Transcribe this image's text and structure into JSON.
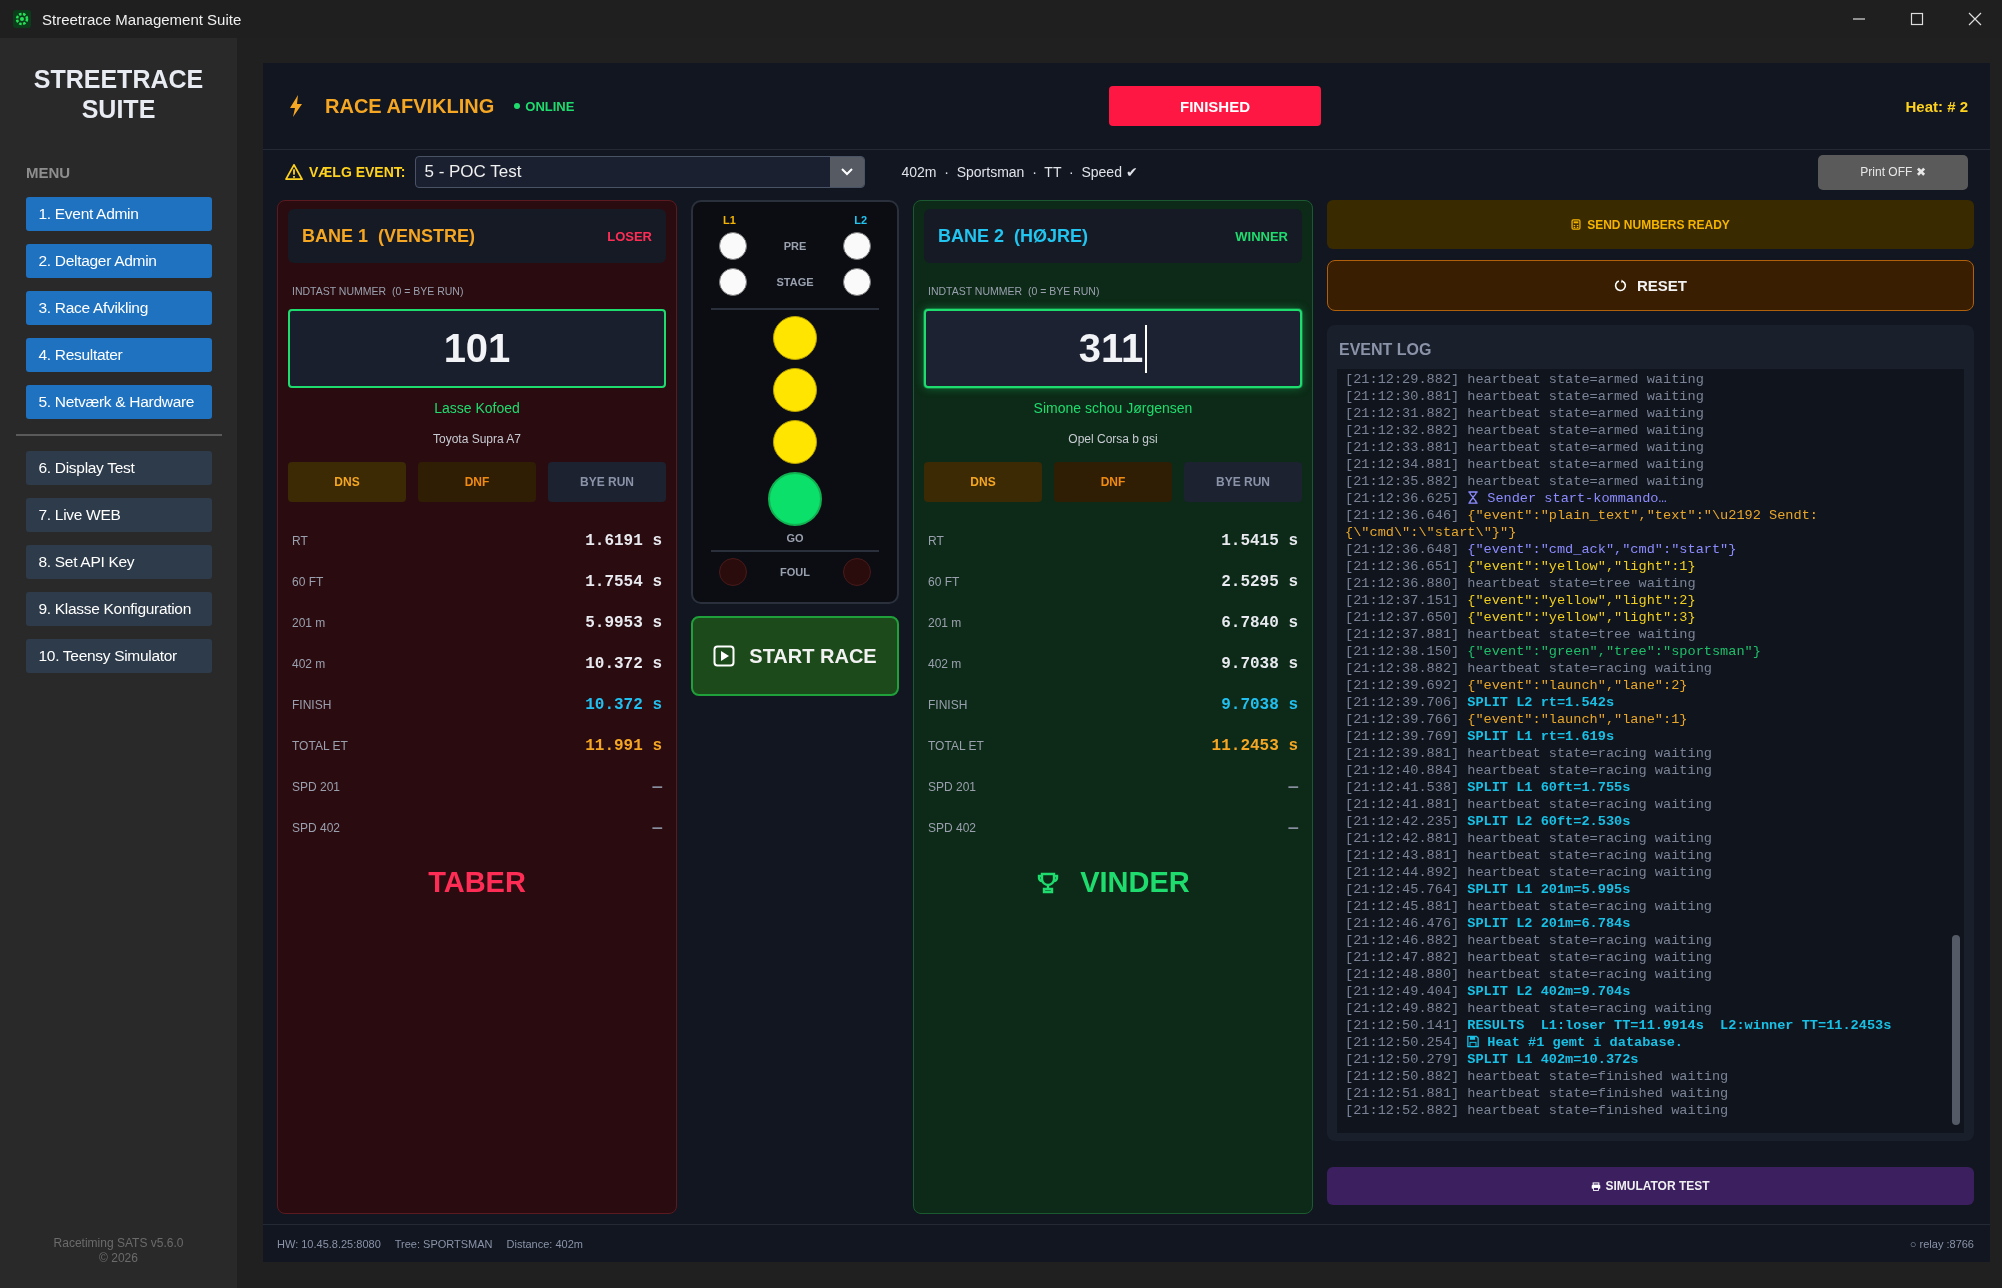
{
  "window": {
    "title": "Streetrace Management Suite"
  },
  "sidebar": {
    "brand": [
      "STREETRACE",
      "SUITE"
    ],
    "menu_label": "MENU",
    "items": [
      {
        "label": "1. Event Admin",
        "kind": "primary"
      },
      {
        "label": "2. Deltager Admin",
        "kind": "primary"
      },
      {
        "label": "3. Race Afvikling",
        "kind": "primary"
      },
      {
        "label": "4. Resultater",
        "kind": "primary"
      },
      {
        "label": "5. Netværk & Hardware",
        "kind": "primary"
      },
      {
        "label": "6. Display Test",
        "kind": "secondary"
      },
      {
        "label": "7. Live WEB",
        "kind": "secondary"
      },
      {
        "label": "8. Set API Key",
        "kind": "secondary"
      },
      {
        "label": "9. Klasse Konfiguration",
        "kind": "secondary"
      },
      {
        "label": "10. Teensy Simulator",
        "kind": "secondary"
      }
    ],
    "footer": [
      "Racetiming SATS v5.6.0",
      "© 2026"
    ]
  },
  "header": {
    "title": "RACE AFVIKLING",
    "connection": "ONLINE",
    "online": true,
    "race_state": "FINISHED",
    "heat": "Heat: # 2"
  },
  "event_bar": {
    "label": "VÆLG EVENT:",
    "selected_event": "5 - POC Test",
    "meta": "402m  ·  Sportsman  ·  TT  ·  Speed ✔",
    "print_button": "Print OFF ✖"
  },
  "lanes": [
    {
      "title": "BANE 1  (VENSTRE)",
      "badge": "LOSER",
      "kind": "loser",
      "input_label": "INDTAST NUMMER  (0 = BYE RUN)",
      "number": "101",
      "focused": false,
      "driver": "Lasse Kofoed",
      "car": "Toyota Supra A7",
      "buttons": [
        {
          "label": "DNS",
          "kind": "dns"
        },
        {
          "label": "DNF",
          "kind": "dnf"
        },
        {
          "label": "BYE RUN",
          "kind": "bye"
        }
      ],
      "stats": [
        {
          "label": "RT",
          "value": "1.6191 s",
          "kind": "time"
        },
        {
          "label": "60 FT",
          "value": "1.7554 s",
          "kind": "time"
        },
        {
          "label": "201 m",
          "value": "5.9953 s",
          "kind": "time"
        },
        {
          "label": "402 m",
          "value": "10.372 s",
          "kind": "time"
        },
        {
          "label": "FINISH",
          "value": "10.372 s",
          "kind": "finish"
        },
        {
          "label": "TOTAL ET",
          "value": "11.991 s",
          "kind": "total"
        },
        {
          "label": "SPD 201",
          "value": "—",
          "kind": "empty"
        },
        {
          "label": "SPD 402",
          "value": "—",
          "kind": "empty"
        }
      ],
      "result_banner": "TABER"
    },
    {
      "title": "BANE 2  (HØJRE)",
      "badge": "WINNER",
      "kind": "winner",
      "input_label": "INDTAST NUMMER  (0 = BYE RUN)",
      "number": "311",
      "focused": true,
      "driver": "Simone schou Jørgensen",
      "car": "Opel Corsa b gsi",
      "buttons": [
        {
          "label": "DNS",
          "kind": "dns"
        },
        {
          "label": "DNF",
          "kind": "dnf"
        },
        {
          "label": "BYE RUN",
          "kind": "bye"
        }
      ],
      "stats": [
        {
          "label": "RT",
          "value": "1.5415 s",
          "kind": "time"
        },
        {
          "label": "60 FT",
          "value": "2.5295 s",
          "kind": "time"
        },
        {
          "label": "201 m",
          "value": "6.7840 s",
          "kind": "time"
        },
        {
          "label": "402 m",
          "value": "9.7038 s",
          "kind": "time"
        },
        {
          "label": "FINISH",
          "value": "9.7038 s",
          "kind": "finish"
        },
        {
          "label": "TOTAL ET",
          "value": "11.2453 s",
          "kind": "total"
        },
        {
          "label": "SPD 201",
          "value": "—",
          "kind": "empty"
        },
        {
          "label": "SPD 402",
          "value": "—",
          "kind": "empty"
        }
      ],
      "result_banner": "VINDER"
    }
  ],
  "tree": {
    "lane_labels": [
      "L1",
      "L2"
    ],
    "stage_rows": [
      {
        "label": "PRE",
        "left_on": true,
        "right_on": true
      },
      {
        "label": "STAGE",
        "left_on": true,
        "right_on": true
      }
    ],
    "ambers": [
      {
        "on": true
      },
      {
        "on": true
      },
      {
        "on": true
      }
    ],
    "go": {
      "label": "GO",
      "on": true
    },
    "foul": {
      "label": "FOUL",
      "left_on": false,
      "right_on": false
    }
  },
  "start_button": "START RACE",
  "actions": {
    "send_numbers": "SEND NUMBERS READY",
    "reset": "RESET",
    "simulator": "SIMULATOR TEST"
  },
  "event_log": {
    "title": "EVENT LOG",
    "lines": [
      {
        "time": "[21:12:29.882]",
        "text": "heartbeat state=armed waiting",
        "kind": "heartbeat"
      },
      {
        "time": "[21:12:30.881]",
        "text": "heartbeat state=armed waiting",
        "kind": "heartbeat"
      },
      {
        "time": "[21:12:31.882]",
        "text": "heartbeat state=armed waiting",
        "kind": "heartbeat"
      },
      {
        "time": "[21:12:32.882]",
        "text": "heartbeat state=armed waiting",
        "kind": "heartbeat"
      },
      {
        "time": "[21:12:33.881]",
        "text": "heartbeat state=armed waiting",
        "kind": "heartbeat"
      },
      {
        "time": "[21:12:34.881]",
        "text": "heartbeat state=armed waiting",
        "kind": "heartbeat"
      },
      {
        "time": "[21:12:35.882]",
        "text": "heartbeat state=armed waiting",
        "kind": "heartbeat"
      },
      {
        "time": "[21:12:36.625]",
        "text": "Sender start-kommando…",
        "kind": "sending"
      },
      {
        "time": "[21:12:36.646]",
        "text": "{\"event\":\"plain_text\",\"text\":\"\\u2192 Sendt: {\\\"cmd\\\":\\\"start\\\"}\"}",
        "kind": "event"
      },
      {
        "time": "[21:12:36.648]",
        "text": "{\"event\":\"cmd_ack\",\"cmd\":\"start\"}",
        "kind": "ack"
      },
      {
        "time": "[21:12:36.651]",
        "text": "{\"event\":\"yellow\",\"light\":1}",
        "kind": "yellow"
      },
      {
        "time": "[21:12:36.880]",
        "text": "heartbeat state=tree waiting",
        "kind": "heartbeat"
      },
      {
        "time": "[21:12:37.151]",
        "text": "{\"event\":\"yellow\",\"light\":2}",
        "kind": "yellow"
      },
      {
        "time": "[21:12:37.650]",
        "text": "{\"event\":\"yellow\",\"light\":3}",
        "kind": "yellow"
      },
      {
        "time": "[21:12:37.881]",
        "text": "heartbeat state=tree waiting",
        "kind": "heartbeat"
      },
      {
        "time": "[21:12:38.150]",
        "text": "{\"event\":\"green\",\"tree\":\"sportsman\"}",
        "kind": "green"
      },
      {
        "time": "[21:12:38.882]",
        "text": "heartbeat state=racing waiting",
        "kind": "heartbeat"
      },
      {
        "time": "[21:12:39.692]",
        "text": "{\"event\":\"launch\",\"lane\":2}",
        "kind": "event"
      },
      {
        "time": "[21:12:39.706]",
        "text": "SPLIT L2 rt=1.542s",
        "kind": "split"
      },
      {
        "time": "[21:12:39.766]",
        "text": "{\"event\":\"launch\",\"lane\":1}",
        "kind": "event"
      },
      {
        "time": "[21:12:39.769]",
        "text": "SPLIT L1 rt=1.619s",
        "kind": "split"
      },
      {
        "time": "[21:12:39.881]",
        "text": "heartbeat state=racing waiting",
        "kind": "heartbeat"
      },
      {
        "time": "[21:12:40.884]",
        "text": "heartbeat state=racing waiting",
        "kind": "heartbeat"
      },
      {
        "time": "[21:12:41.538]",
        "text": "SPLIT L1 60ft=1.755s",
        "kind": "split"
      },
      {
        "time": "[21:12:41.881]",
        "text": "heartbeat state=racing waiting",
        "kind": "heartbeat"
      },
      {
        "time": "[21:12:42.235]",
        "text": "SPLIT L2 60ft=2.530s",
        "kind": "split"
      },
      {
        "time": "[21:12:42.881]",
        "text": "heartbeat state=racing waiting",
        "kind": "heartbeat"
      },
      {
        "time": "[21:12:43.881]",
        "text": "heartbeat state=racing waiting",
        "kind": "heartbeat"
      },
      {
        "time": "[21:12:44.892]",
        "text": "heartbeat state=racing waiting",
        "kind": "heartbeat"
      },
      {
        "time": "[21:12:45.764]",
        "text": "SPLIT L1 201m=5.995s",
        "kind": "split"
      },
      {
        "time": "[21:12:45.881]",
        "text": "heartbeat state=racing waiting",
        "kind": "heartbeat"
      },
      {
        "time": "[21:12:46.476]",
        "text": "SPLIT L2 201m=6.784s",
        "kind": "split"
      },
      {
        "time": "[21:12:46.882]",
        "text": "heartbeat state=racing waiting",
        "kind": "heartbeat"
      },
      {
        "time": "[21:12:47.882]",
        "text": "heartbeat state=racing waiting",
        "kind": "heartbeat"
      },
      {
        "time": "[21:12:48.880]",
        "text": "heartbeat state=racing waiting",
        "kind": "heartbeat"
      },
      {
        "time": "[21:12:49.404]",
        "text": "SPLIT L2 402m=9.704s",
        "kind": "split"
      },
      {
        "time": "[21:12:49.882]",
        "text": "heartbeat state=racing waiting",
        "kind": "heartbeat"
      },
      {
        "time": "[21:12:50.141]",
        "text": "RESULTS  L1:loser TT=11.9914s  L2:winner TT=11.2453s",
        "kind": "split"
      },
      {
        "time": "[21:12:50.254]",
        "text": "Heat #1 gemt i database.",
        "kind": "saved"
      },
      {
        "time": "[21:12:50.279]",
        "text": "SPLIT L1 402m=10.372s",
        "kind": "split"
      },
      {
        "time": "[21:12:50.882]",
        "text": "heartbeat state=finished waiting",
        "kind": "heartbeat"
      },
      {
        "time": "[21:12:51.881]",
        "text": "heartbeat state=finished waiting",
        "kind": "heartbeat"
      },
      {
        "time": "[21:12:52.882]",
        "text": "heartbeat state=finished waiting",
        "kind": "heartbeat"
      }
    ]
  },
  "status_bar": {
    "items": [
      "HW: 10.45.8.25:8080",
      "Tree: SPORTSMAN",
      "Distance: 402m"
    ],
    "relay": "○ relay :8766"
  }
}
